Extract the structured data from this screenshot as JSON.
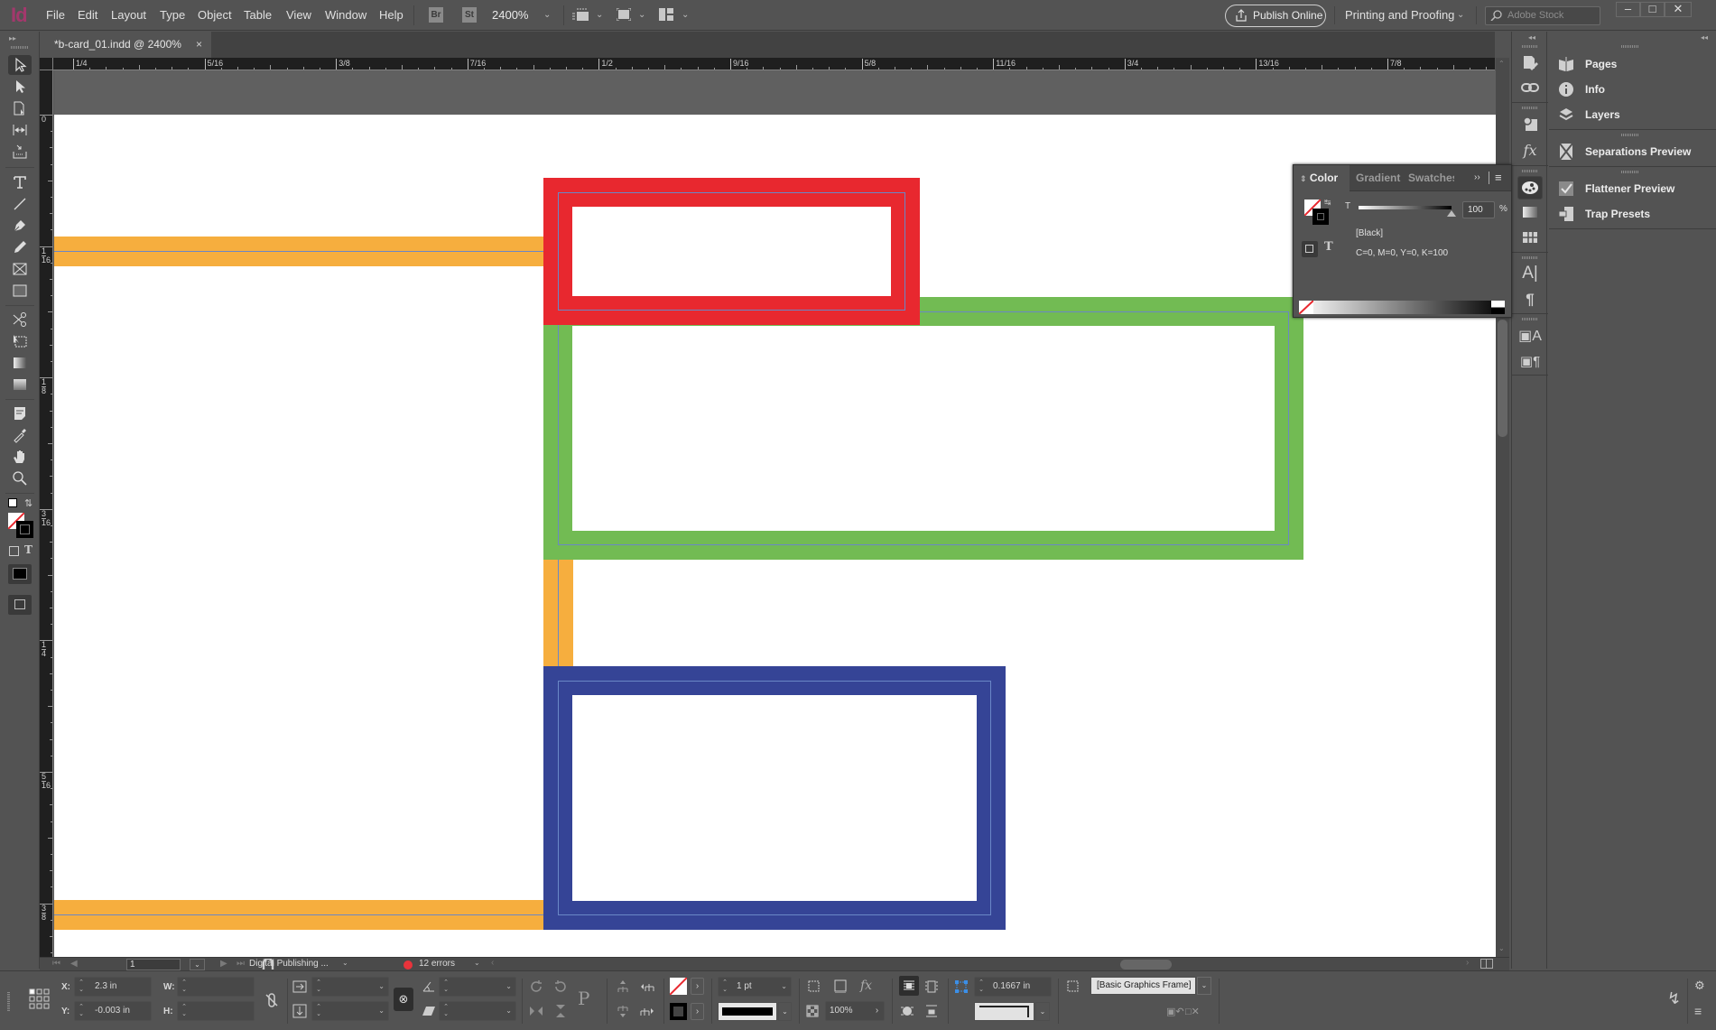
{
  "app": {
    "logo": "Id",
    "menu": [
      "File",
      "Edit",
      "Layout",
      "Type",
      "Object",
      "Table",
      "View",
      "Window",
      "Help"
    ],
    "bridge_badge": "Br",
    "stock_badge": "St",
    "zoom_level": "2400%",
    "publish_button": "Publish Online",
    "workspace": "Printing and Proofing",
    "stock_search_placeholder": "Adobe Stock",
    "window_controls": {
      "minimize": "–",
      "maximize": "□",
      "close": "✕"
    }
  },
  "document": {
    "tab_title": "*b-card_01.indd @ 2400%",
    "tab_close": "×"
  },
  "rulers": {
    "horizontal": [
      "1/4",
      "5/16",
      "3/8",
      "7/16",
      "1/2",
      "9/16",
      "5/8",
      "11/16",
      "3/4",
      "13/16",
      "7/8"
    ],
    "vertical": [
      [
        "0",
        ""
      ],
      [
        "1",
        "16"
      ],
      [
        "1",
        "8"
      ],
      [
        "3",
        "16"
      ],
      [
        "1",
        "4"
      ],
      [
        "5",
        "16"
      ],
      [
        "3",
        "8"
      ]
    ]
  },
  "canvas": {
    "colors": {
      "red": "#e8282f",
      "green": "#72bb53",
      "blue": "#354496",
      "orange": "#f6ae3e",
      "guide": "#6a87c6"
    },
    "frames": [
      {
        "name": "red-frame",
        "color": "red"
      },
      {
        "name": "green-frame",
        "color": "green"
      },
      {
        "name": "blue-frame",
        "color": "blue"
      },
      {
        "name": "orange-bar-top",
        "color": "orange"
      },
      {
        "name": "orange-bar-vertical",
        "color": "orange"
      },
      {
        "name": "orange-bar-bottom",
        "color": "orange"
      }
    ]
  },
  "status_bar": {
    "page_number": "1",
    "preflight_profile": "Digital Publishing ...",
    "error_count": "12 errors"
  },
  "tools": [
    "selection-tool",
    "direct-selection-tool",
    "page-tool",
    "gap-tool",
    "content-collector-tool",
    "type-tool",
    "line-tool",
    "pen-tool",
    "pencil-tool",
    "rectangle-frame-tool",
    "rectangle-tool",
    "scissors-tool",
    "free-transform-tool",
    "gradient-swatch-tool",
    "gradient-feather-tool",
    "note-tool",
    "eyedropper-tool",
    "hand-tool",
    "zoom-tool"
  ],
  "panels": {
    "dock": [
      "Pages",
      "Info",
      "Layers",
      "Separations Preview",
      "Flattener Preview",
      "Trap Presets"
    ],
    "color_panel": {
      "tabs": [
        "Color",
        "Gradient",
        "Swatches"
      ],
      "tint_label": "T",
      "tint_value": "100",
      "tint_unit": "%",
      "tint_percent": 100,
      "swatch_name": "[Black]",
      "cmyk": "C=0, M=0, Y=0, K=100",
      "type_label": "T"
    }
  },
  "control_bar": {
    "x_label": "X:",
    "x_value": "2.3 in",
    "y_label": "Y:",
    "y_value": "-0.003 in",
    "w_label": "W:",
    "w_value": "",
    "h_label": "H:",
    "h_value": "",
    "stroke_weight": "1 pt",
    "opacity": "100%",
    "corner_size": "0.1667 in",
    "object_style": "[Basic Graphics Frame]"
  }
}
